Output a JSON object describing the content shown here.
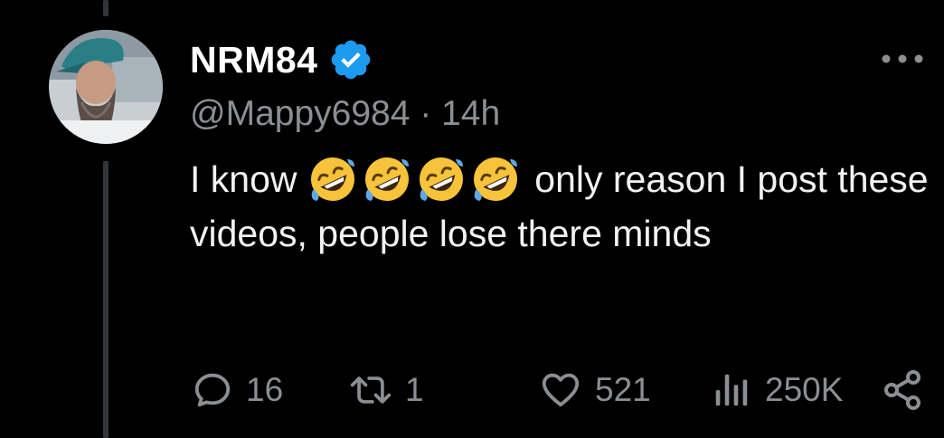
{
  "tweet": {
    "author": {
      "display_name": "NRM84",
      "handle": "@Mappy6984",
      "verified": true
    },
    "time_separator": "·",
    "timestamp": "14h",
    "text_before_emoji": "I know ",
    "emojis": [
      "rolling-on-floor-laughing",
      "rolling-on-floor-laughing",
      "rolling-on-floor-laughing",
      "rolling-on-floor-laughing"
    ],
    "text_after_emoji": " only reason I post these videos,  people lose there minds"
  },
  "actions": {
    "replies": "16",
    "reposts": "1",
    "likes": "521",
    "views": "250K"
  },
  "icons": {
    "verified": "verified-badge-icon",
    "more": "more-options-icon",
    "reply": "reply-icon",
    "repost": "repost-icon",
    "like": "heart-icon",
    "views": "views-chart-icon",
    "share": "share-icon"
  },
  "colors": {
    "background": "#000000",
    "text_primary": "#ffffff",
    "text_secondary": "#8b8f93",
    "verified_blue": "#1d9bf0",
    "thread_line": "#333639"
  }
}
